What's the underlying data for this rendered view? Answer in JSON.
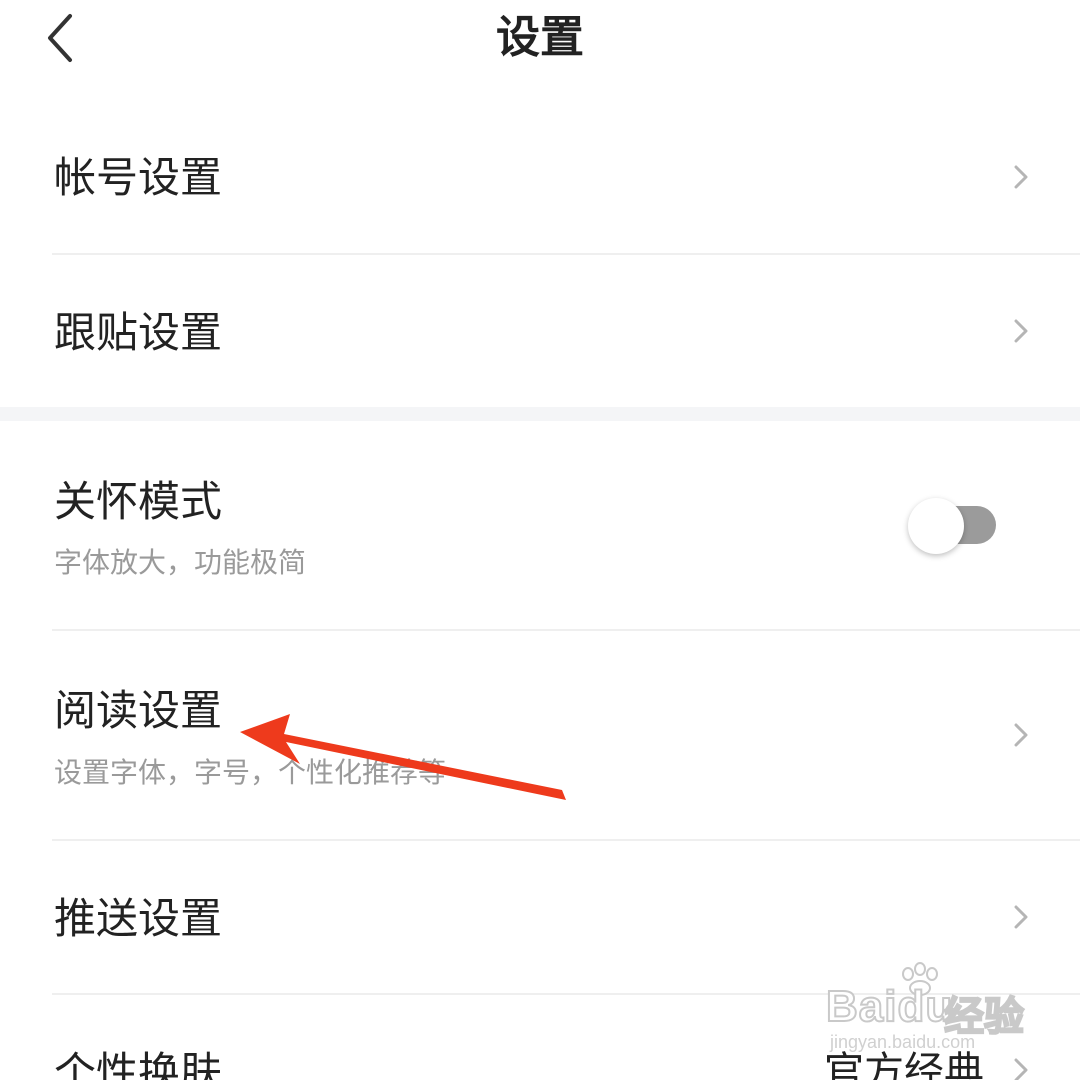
{
  "header": {
    "title": "设置",
    "back_icon": "chevron-left-icon"
  },
  "settings": {
    "account": {
      "label": "帐号设置"
    },
    "follow_post": {
      "label": "跟贴设置"
    },
    "care_mode": {
      "label": "关怀模式",
      "description": "字体放大，功能极简",
      "enabled": false
    },
    "reading": {
      "label": "阅读设置",
      "description": "设置字体，字号，个性化推荐等"
    },
    "push": {
      "label": "推送设置"
    },
    "theme": {
      "label": "个性换肤",
      "value": "官方经典"
    }
  },
  "annotation": {
    "arrow_color": "#ee3a1c"
  },
  "watermark": {
    "logo": "Baidu",
    "suffix": "经验",
    "url": "jingyan.baidu.com"
  },
  "colors": {
    "background": "#ffffff",
    "group_gap": "#f4f5f7",
    "divider": "#efefef",
    "subtext": "#9a9a9a",
    "toggle_off": "#9b9b9b"
  }
}
